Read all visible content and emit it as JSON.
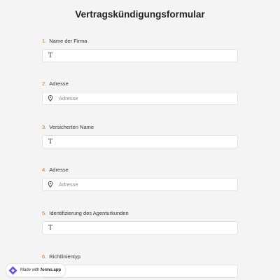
{
  "form": {
    "title": "Vertragskündigungsformular",
    "questions": [
      {
        "number": "1.",
        "label": "Name der Firma",
        "icon": "text-icon",
        "placeholder": ""
      },
      {
        "number": "2.",
        "label": "Adresse",
        "icon": "location-pin-icon",
        "placeholder": "Adresse"
      },
      {
        "number": "3.",
        "label": "Versicherten Name",
        "icon": "text-icon",
        "placeholder": ""
      },
      {
        "number": "4.",
        "label": "Adresse",
        "icon": "location-pin-icon",
        "placeholder": "Adresse"
      },
      {
        "number": "5.",
        "label": "Identifizierung des Agenturkunden",
        "icon": "text-icon",
        "placeholder": ""
      },
      {
        "number": "6.",
        "label": "Richtlinientyp",
        "icon": "",
        "placeholder": ""
      }
    ]
  },
  "badge": {
    "made_with": "Made with",
    "brand": "forms.app"
  },
  "colors": {
    "background": "#f4f4f4",
    "number_accent": "#c07a2c",
    "brand_purple": "#6b4de6"
  }
}
